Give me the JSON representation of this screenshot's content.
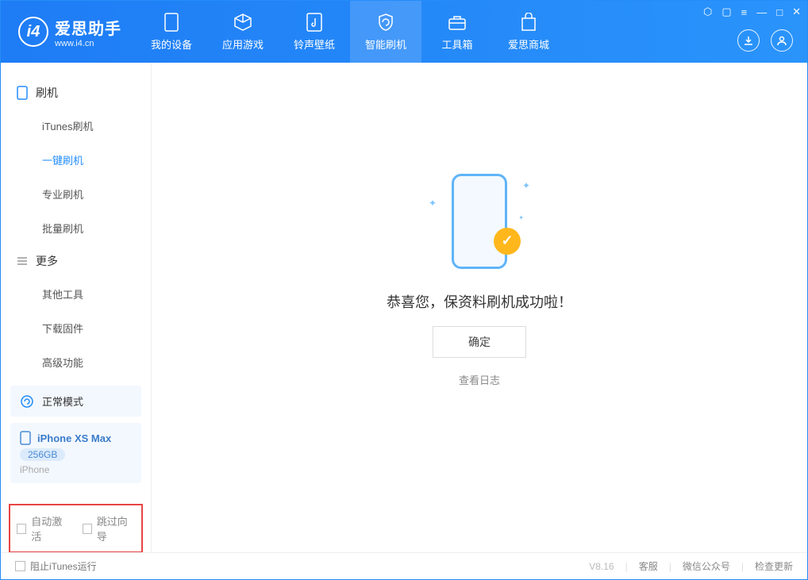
{
  "header": {
    "logo_text": "爱思助手",
    "logo_sub": "www.i4.cn",
    "tabs": [
      {
        "label": "我的设备"
      },
      {
        "label": "应用游戏"
      },
      {
        "label": "铃声壁纸"
      },
      {
        "label": "智能刷机"
      },
      {
        "label": "工具箱"
      },
      {
        "label": "爱思商城"
      }
    ]
  },
  "sidebar": {
    "group1_title": "刷机",
    "group1_items": [
      "iTunes刷机",
      "一键刷机",
      "专业刷机",
      "批量刷机"
    ],
    "group2_title": "更多",
    "group2_items": [
      "其他工具",
      "下载固件",
      "高级功能"
    ],
    "mode_label": "正常模式",
    "device_name": "iPhone XS Max",
    "device_capacity": "256GB",
    "device_type": "iPhone",
    "checkbox1": "自动激活",
    "checkbox2": "跳过向导"
  },
  "main": {
    "success_msg": "恭喜您，保资料刷机成功啦！",
    "ok_button": "确定",
    "log_link": "查看日志"
  },
  "footer": {
    "block_itunes": "阻止iTunes运行",
    "version": "V8.16",
    "link1": "客服",
    "link2": "微信公众号",
    "link3": "检查更新"
  }
}
